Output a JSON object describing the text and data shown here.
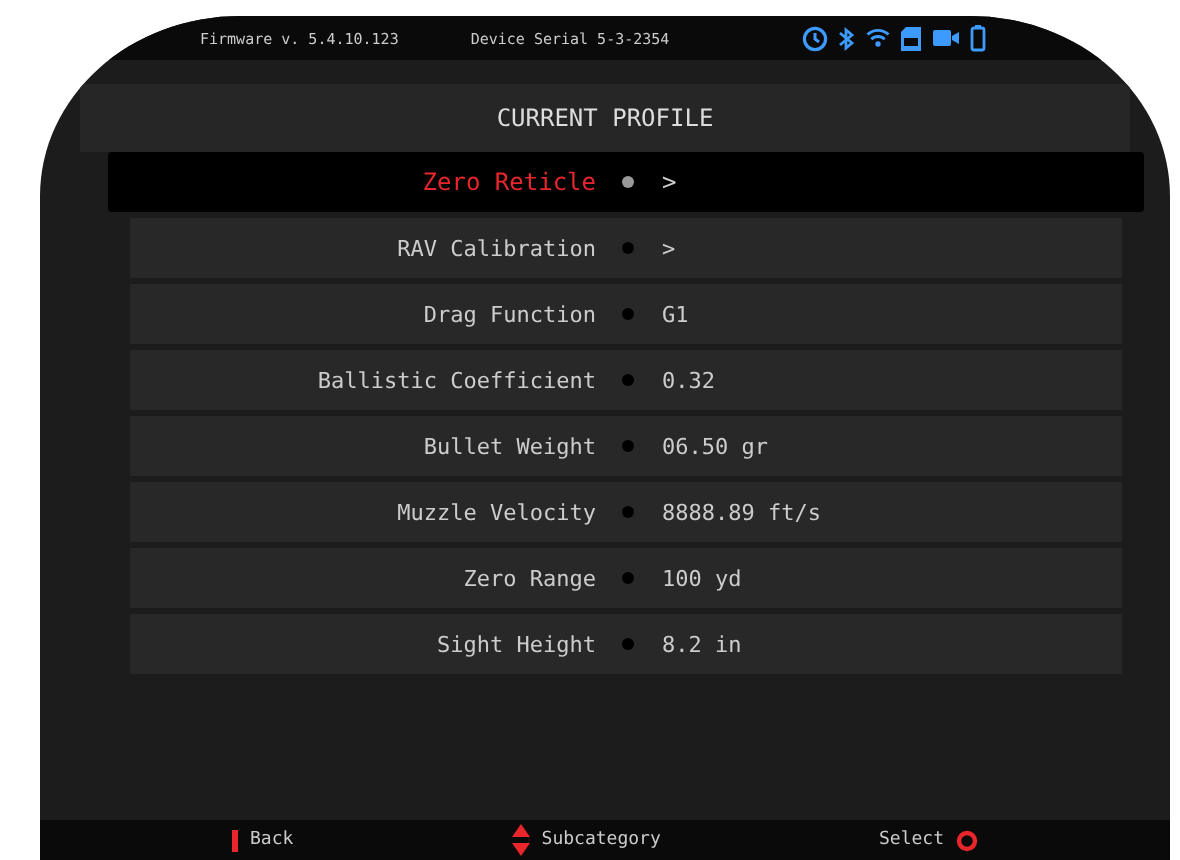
{
  "status_bar": {
    "firmware": "Firmware v. 5.4.10.123",
    "serial": "Device Serial 5-3-2354"
  },
  "title": "CURRENT PROFILE",
  "rows": [
    {
      "label": "Zero Reticle",
      "value": ">",
      "selected": true
    },
    {
      "label": "RAV Calibration",
      "value": ">",
      "selected": false
    },
    {
      "label": "Drag Function",
      "value": "G1",
      "selected": false
    },
    {
      "label": "Ballistic Coefficient",
      "value": "0.32",
      "selected": false
    },
    {
      "label": "Bullet Weight",
      "value": "06.50 gr",
      "selected": false
    },
    {
      "label": "Muzzle Velocity",
      "value": "8888.89 ft/s",
      "selected": false
    },
    {
      "label": "Zero Range",
      "value": "100 yd",
      "selected": false
    },
    {
      "label": "Sight Height",
      "value": "8.2 in",
      "selected": false
    }
  ],
  "footer": {
    "back": "Back",
    "subcategory": "Subcategory",
    "select": "Select"
  }
}
